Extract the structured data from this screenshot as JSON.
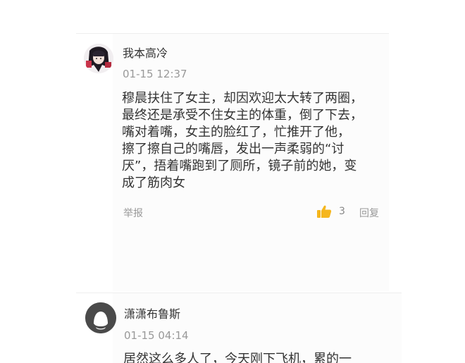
{
  "comments": [
    {
      "username": "我本高冷",
      "time": "01-15 12:37",
      "body_lines": [
        "穆晨扶住了女主，却因欢迎太大转了两圈，",
        "最终还是承受不住女主的体重，倒了下去，",
        "嘴对着嘴，女主的脸红了，忙推开了他，",
        "擦了擦自己的嘴唇，发出一声柔弱的“讨",
        "厌”，捂着嘴跑到了厕所，镜子前的她，变",
        "成了筋肉女"
      ],
      "report_label": "举报",
      "like_count": "3",
      "reply_label": "回复"
    },
    {
      "username": "潇潇布鲁斯",
      "time": "01-15 04:14",
      "body_lines": [
        "居然这么多人了，今天刚下飞机，累的一"
      ]
    }
  ],
  "colors": {
    "like_icon": "#f5b61d",
    "default_avatar": "#4a4a4a"
  }
}
